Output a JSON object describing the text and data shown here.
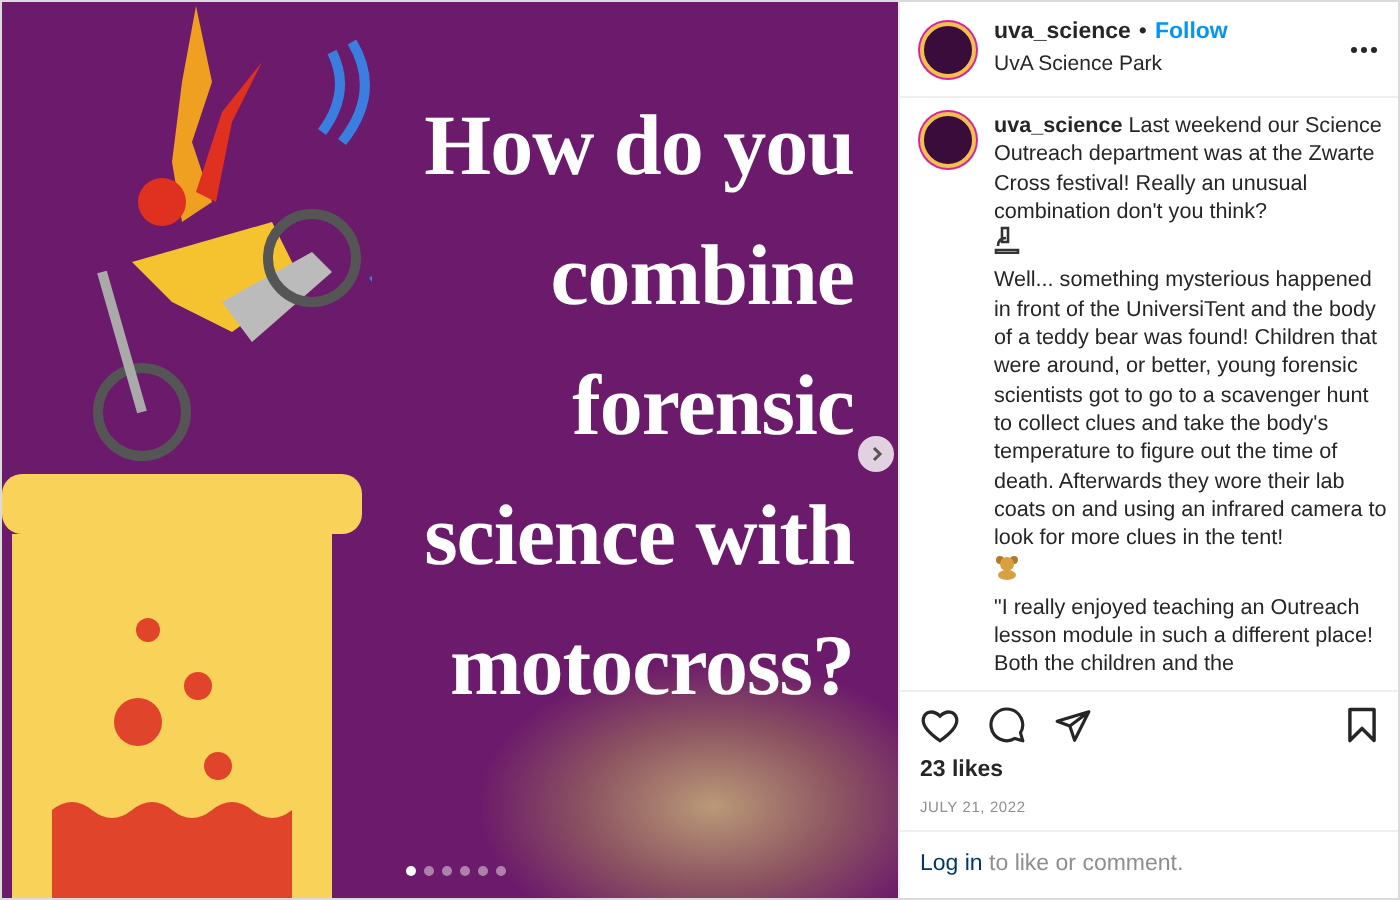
{
  "post_image": {
    "headline_lines": [
      "How do you",
      "combine",
      "forensic",
      "science with",
      "motocross?"
    ],
    "slides": [
      {
        "selected": true
      },
      {
        "selected": false
      },
      {
        "selected": false
      },
      {
        "selected": false
      },
      {
        "selected": false
      },
      {
        "selected": false
      }
    ]
  },
  "header": {
    "username": "uva_science",
    "separator": "•",
    "follow": "Follow",
    "location": "UvA Science Park"
  },
  "caption": {
    "paragraphs": [
      "**uva_science** Last weekend our Science Outreach department was at the Zwarte Cross festival! Really an unusual combination don't you think?",
      "Well... something mysterious happened in front of the UniversiTent and the body of a teddy bear was found! Children that were around, or better, young forensic scientists got to go to a scavenger hunt to collect clues and take the body's temperature to figure out the time of death. Afterwards they wore their lab coats on and using an infrared camera to look for more clues in the tent!",
      "\"I really enjoyed teaching an Outreach lesson module in such a different place! Both the children and the"
    ]
  },
  "likes": "23 likes",
  "date": "JULY 21, 2022",
  "login": {
    "link": "Log in",
    "rest": "to like or comment."
  }
}
